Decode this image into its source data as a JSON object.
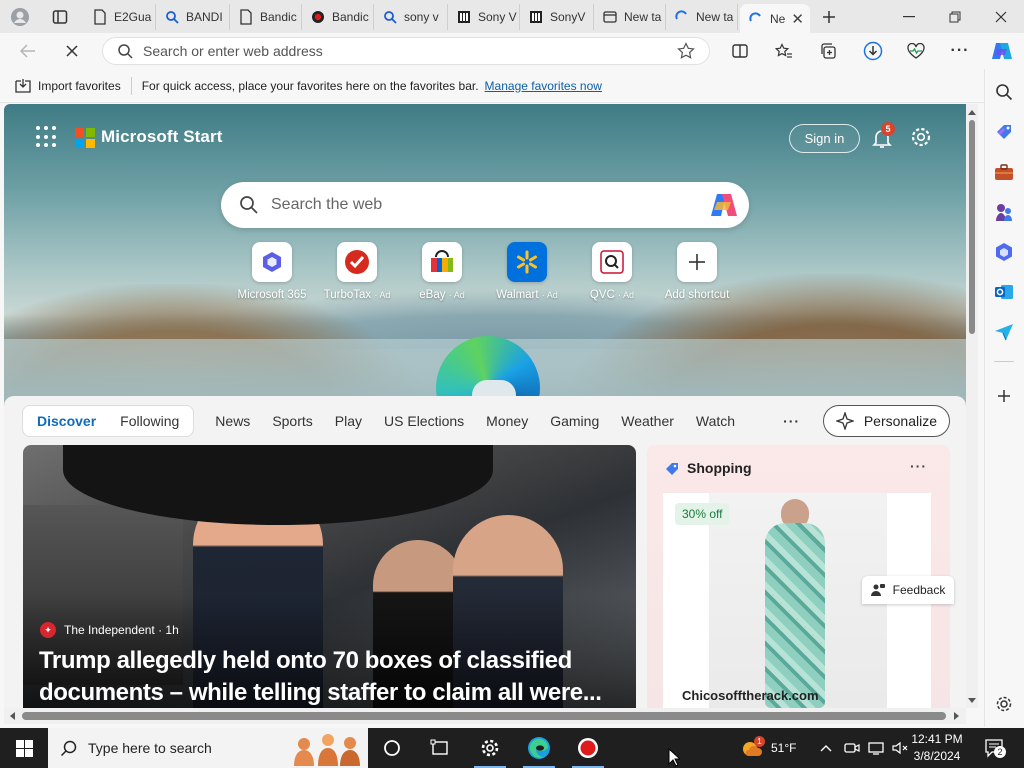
{
  "tabs": [
    {
      "title": "E2Gua",
      "favicon": "page-icon"
    },
    {
      "title": "BANDI",
      "favicon": "search-icon"
    },
    {
      "title": "Bandic",
      "favicon": "page-icon"
    },
    {
      "title": "Bandic",
      "favicon": "record-icon"
    },
    {
      "title": "sony v",
      "favicon": "search-icon"
    },
    {
      "title": "Sony V",
      "favicon": "sony-icon"
    },
    {
      "title": "SonyV",
      "favicon": "sony-icon"
    },
    {
      "title": "New ta",
      "favicon": "newtab-icon"
    },
    {
      "title": "New ta",
      "favicon": "loading-icon"
    },
    {
      "title": "Ne",
      "favicon": "loading-icon",
      "active": true
    }
  ],
  "toolbar": {
    "address_placeholder": "Search or enter web address"
  },
  "favorites_bar": {
    "import_label": "Import favorites",
    "message": "For quick access, place your favorites here on the favorites bar.",
    "link": "Manage favorites now"
  },
  "start": {
    "brand": "Microsoft Start",
    "sign_in": "Sign in",
    "notification_count": "5",
    "search_placeholder": "Search the web",
    "shortcuts": [
      {
        "label": "Microsoft 365",
        "ad": "",
        "icon": "m365-icon"
      },
      {
        "label": "TurboTax",
        "ad": "· Ad",
        "icon": "turbotax-icon"
      },
      {
        "label": "eBay",
        "ad": "· Ad",
        "icon": "ebay-icon"
      },
      {
        "label": "Walmart",
        "ad": "· Ad",
        "icon": "walmart-icon"
      },
      {
        "label": "QVC",
        "ad": "· Ad",
        "icon": "qvc-icon"
      },
      {
        "label": "Add shortcut",
        "ad": "",
        "icon": "plus-icon"
      }
    ]
  },
  "feed": {
    "nav": {
      "pill": [
        "Discover",
        "Following"
      ],
      "items": [
        "News",
        "Sports",
        "Play",
        "US Elections",
        "Money",
        "Gaming",
        "Weather",
        "Watch"
      ],
      "more": "···",
      "personalize": "Personalize"
    },
    "hero": {
      "source": "The Independent · 1h",
      "headline": "Trump allegedly held onto 70 boxes of classified documents – while telling staffer to claim all were..."
    },
    "shopping": {
      "title": "Shopping",
      "discount": "30% off",
      "store": "Chicosofftherack.com"
    },
    "feedback": "Feedback"
  },
  "taskbar": {
    "search_placeholder": "Type here to search",
    "temperature": "51°F",
    "weather_badge": "1",
    "time": "12:41 PM",
    "date": "3/8/2024",
    "notifications": "2"
  },
  "colors": {
    "accent": "#0f6cbd",
    "ms_logo": [
      "#f25022",
      "#7fba00",
      "#00a4ef",
      "#ffb900"
    ],
    "badge": "#d6452c"
  }
}
